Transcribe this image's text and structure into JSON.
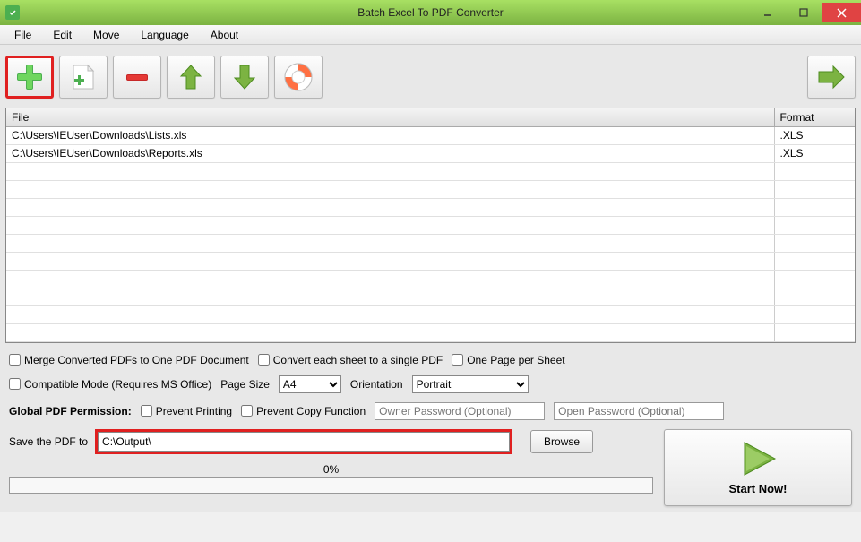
{
  "window": {
    "title": "Batch Excel To PDF Converter"
  },
  "menubar": {
    "items": [
      "File",
      "Edit",
      "Move",
      "Language",
      "About"
    ]
  },
  "toolbar": {
    "add": "add-file",
    "add_folder": "add-folder",
    "remove": "remove",
    "move_up": "move-up",
    "move_down": "move-down",
    "help": "help",
    "convert": "convert"
  },
  "file_table": {
    "headers": {
      "file": "File",
      "format": "Format"
    },
    "rows": [
      {
        "file": "C:\\Users\\IEUser\\Downloads\\Lists.xls",
        "format": ".XLS"
      },
      {
        "file": "C:\\Users\\IEUser\\Downloads\\Reports.xls",
        "format": ".XLS"
      }
    ]
  },
  "options": {
    "merge_pdfs": "Merge Converted PDFs to One PDF Document",
    "convert_each_sheet": "Convert each sheet to a single PDF",
    "one_page_per_sheet": "One Page per Sheet",
    "compatible_mode": "Compatible Mode (Requires MS Office)",
    "page_size_label": "Page Size",
    "page_size_value": "A4",
    "orientation_label": "Orientation",
    "orientation_value": "Portrait"
  },
  "permissions": {
    "label": "Global PDF Permission:",
    "prevent_printing": "Prevent Printing",
    "prevent_copy": "Prevent Copy Function",
    "owner_pw_placeholder": "Owner Password (Optional)",
    "open_pw_placeholder": "Open Password (Optional)"
  },
  "output": {
    "save_label": "Save the PDF to",
    "path_value": "C:\\Output\\",
    "browse": "Browse"
  },
  "progress": {
    "percent": "0%"
  },
  "start": {
    "label": "Start Now!"
  }
}
